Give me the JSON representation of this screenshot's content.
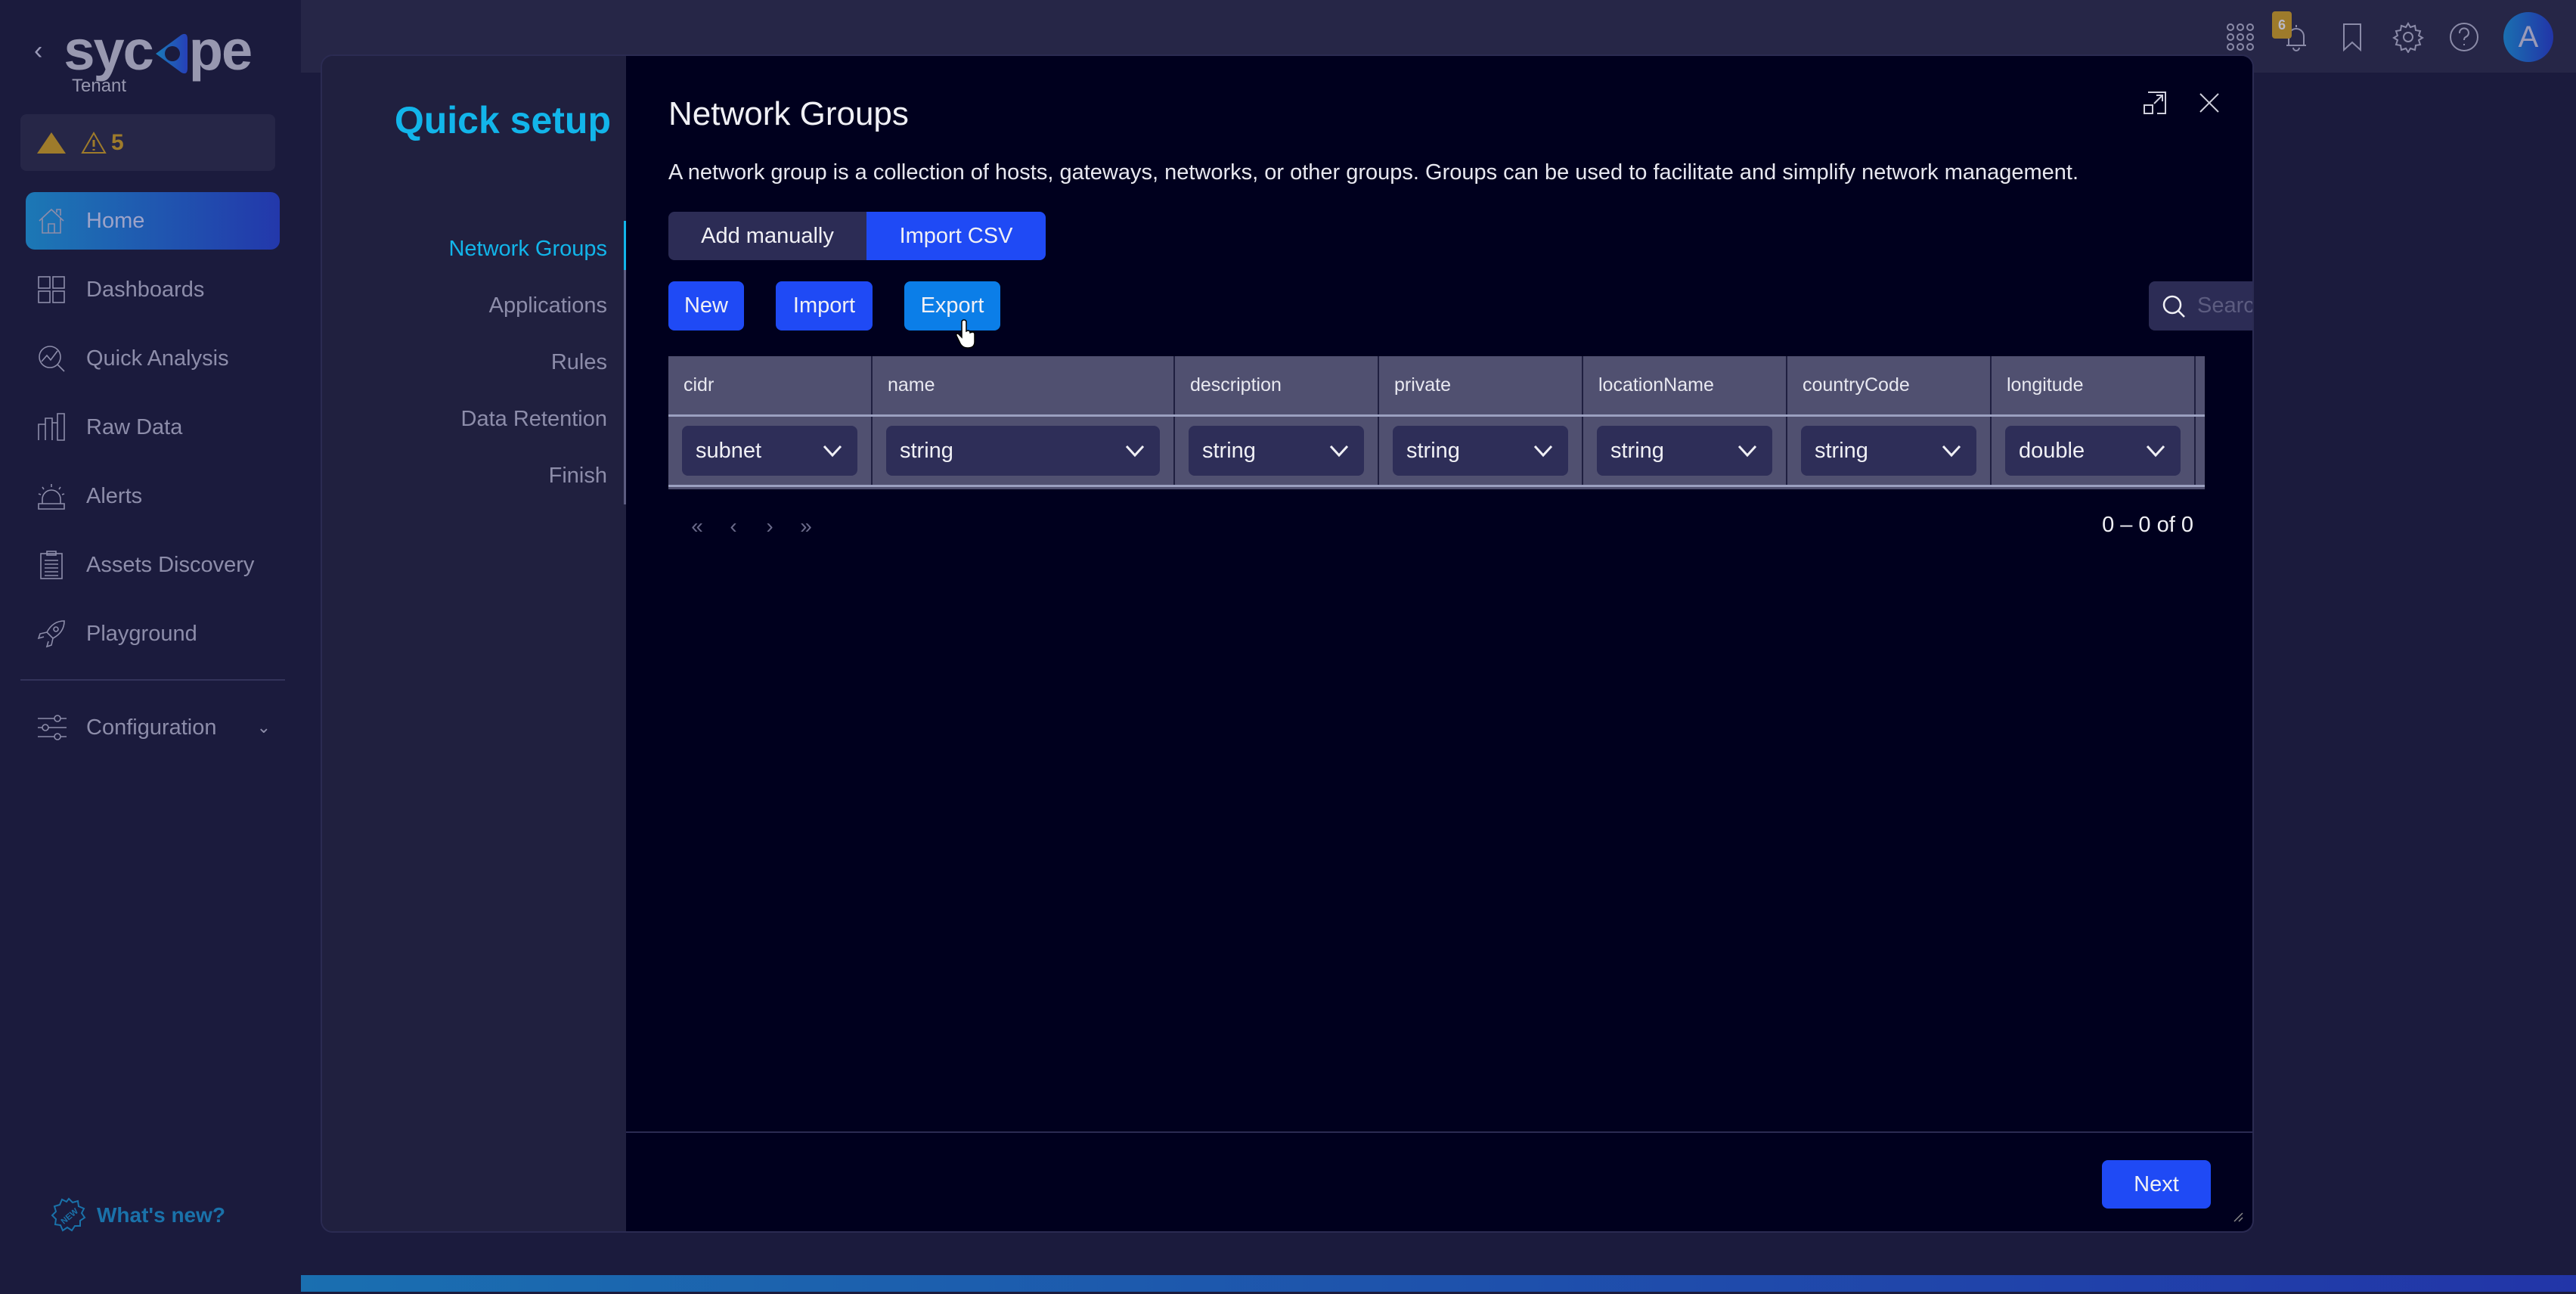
{
  "topbar": {
    "icons": [
      "apps-grid-icon",
      "bell-icon",
      "bookmark-icon",
      "gear-icon",
      "help-icon"
    ],
    "notification_count": "6",
    "avatar_initial": "A"
  },
  "sidebar": {
    "logo": "sycope",
    "logo_left": "syc",
    "logo_right": "pe",
    "tenant": "Tenant",
    "alerts_count": "5",
    "items": [
      {
        "label": "Home",
        "icon": "home-icon",
        "active": true
      },
      {
        "label": "Dashboards",
        "icon": "dashboard-icon"
      },
      {
        "label": "Quick Analysis",
        "icon": "quick-analysis-icon"
      },
      {
        "label": "Raw Data",
        "icon": "bar-chart-icon"
      },
      {
        "label": "Alerts",
        "icon": "siren-icon"
      },
      {
        "label": "Assets Discovery",
        "icon": "clipboard-icon"
      },
      {
        "label": "Playground",
        "icon": "rocket-icon"
      }
    ],
    "configuration": "Configuration",
    "whats_new": "What's new?"
  },
  "modal": {
    "quick_setup_title": "Quick setup",
    "steps": [
      {
        "label": "Network Groups",
        "active": true
      },
      {
        "label": "Applications"
      },
      {
        "label": "Rules"
      },
      {
        "label": "Data Retention"
      },
      {
        "label": "Finish"
      }
    ],
    "title": "Network Groups",
    "description": "A network group is a collection of hosts, gateways, networks, or other groups. Groups can be used to facilitate and simplify network management.",
    "tabs": [
      {
        "label": "Add manually",
        "active": false
      },
      {
        "label": "Import CSV",
        "active": true
      }
    ],
    "actions": {
      "new": "New",
      "import": "Import",
      "export": "Export"
    },
    "search": {
      "placeholder": "Search",
      "value": ""
    },
    "table": {
      "columns": [
        {
          "header": "cidr",
          "type": "subnet"
        },
        {
          "header": "name",
          "type": "string"
        },
        {
          "header": "description",
          "type": "string"
        },
        {
          "header": "private",
          "type": "string"
        },
        {
          "header": "locationName",
          "type": "string"
        },
        {
          "header": "countryCode",
          "type": "string"
        },
        {
          "header": "longitude",
          "type": "double"
        }
      ]
    },
    "pagination": {
      "first": "«",
      "prev": "‹",
      "next": "›",
      "last": "»",
      "range": "0 – 0 of 0"
    },
    "next_button": "Next"
  }
}
